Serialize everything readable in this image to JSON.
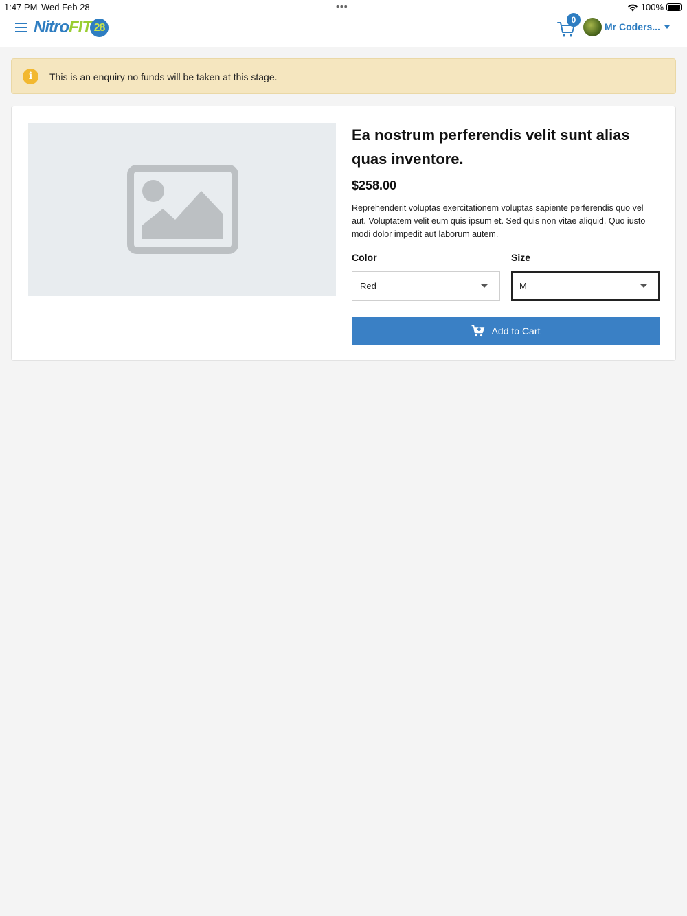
{
  "status_bar": {
    "time": "1:47 PM",
    "date": "Wed Feb 28",
    "multitask_dots": "•••",
    "battery": "100%",
    "battery_level": 1.0
  },
  "header": {
    "logo": {
      "part1": "Nitro",
      "part2": "FIT",
      "part3": "28"
    },
    "cart_count": "0",
    "user_name": "Mr Coders...",
    "icons": {
      "menu": "hamburger-menu-icon",
      "cart": "shopping-cart-icon",
      "user_menu": "caret-down-icon"
    }
  },
  "alert": {
    "icon": "info-icon",
    "icon_glyph": "i",
    "message": "This is an enquiry no funds will be taken at this stage."
  },
  "product": {
    "image": "image-placeholder-icon",
    "title": "Ea nostrum perferendis velit sunt alias quas inventore.",
    "price": "$258.00",
    "description": "Reprehenderit voluptas exercitationem voluptas sapiente perferendis quo vel aut. Voluptatem velit eum quis ipsum et. Sed quis non vitae aliquid. Quo iusto modi dolor impedit aut laborum autem.",
    "color": {
      "label": "Color",
      "selected": "Red"
    },
    "size": {
      "label": "Size",
      "selected": "M"
    },
    "add_to_cart_label": "Add to Cart"
  },
  "colors": {
    "brand_blue": "#2e7dc1",
    "brand_green": "#9acd32",
    "button_blue": "#3a80c5",
    "alert_bg": "#f5e6bf",
    "alert_icon": "#f2b830",
    "page_bg": "#f4f4f4"
  }
}
